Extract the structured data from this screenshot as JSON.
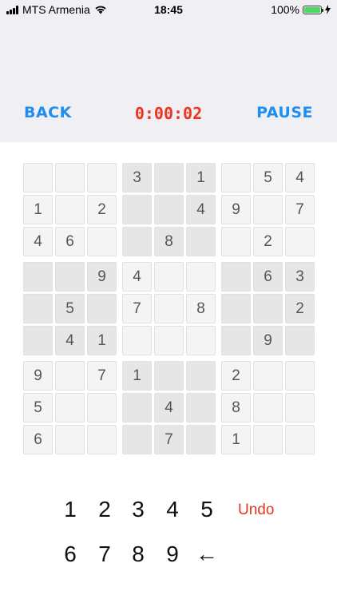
{
  "status": {
    "carrier": "MTS Armenia",
    "time": "18:45",
    "battery": "100%",
    "battery_level": 1.0
  },
  "header": {
    "back_label": "BACK",
    "timer": "0:00:02",
    "pause_label": "PAUSE"
  },
  "board": [
    [
      "",
      "",
      "",
      "3",
      "",
      "1",
      "",
      "5",
      "4"
    ],
    [
      "1",
      "",
      "2",
      "",
      "",
      "4",
      "9",
      "",
      "7"
    ],
    [
      "4",
      "6",
      "",
      "",
      "8",
      "",
      "",
      "2",
      ""
    ],
    [
      "",
      "",
      "9",
      "4",
      "",
      "",
      "",
      "6",
      "3"
    ],
    [
      "",
      "5",
      "",
      "7",
      "",
      "8",
      "",
      "",
      "2"
    ],
    [
      "",
      "4",
      "1",
      "",
      "",
      "",
      "",
      "9",
      ""
    ],
    [
      "9",
      "",
      "7",
      "1",
      "",
      "",
      "2",
      "",
      ""
    ],
    [
      "5",
      "",
      "",
      "",
      "4",
      "",
      "8",
      "",
      ""
    ],
    [
      "6",
      "",
      "",
      "",
      "7",
      "",
      "1",
      "",
      ""
    ]
  ],
  "keypad": {
    "row1": [
      "1",
      "2",
      "3",
      "4",
      "5"
    ],
    "row2": [
      "6",
      "7",
      "8",
      "9",
      "←"
    ],
    "undo_label": "Undo"
  },
  "colors": {
    "accent": "#1e8ff0",
    "timer": "#f0321e",
    "undo": "#e0381e"
  }
}
